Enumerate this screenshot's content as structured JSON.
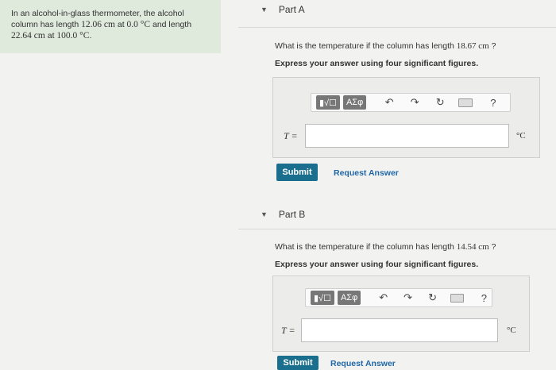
{
  "problem": {
    "line1": "In an alcohol-in-glass thermometer, the alcohol",
    "line2_pre": "column has length ",
    "line2_len": "12.06 cm",
    "line2_mid": " at ",
    "line2_temp": "0.0 °C",
    "line2_post": " and length",
    "line3_len": "22.64 cm",
    "line3_mid": " at ",
    "line3_temp": "100.0 °C",
    "line3_post": "."
  },
  "part_a": {
    "title": "Part A",
    "question_pre": "What is the temperature if the column has length ",
    "question_value": "18.67 cm",
    "question_post": " ?",
    "instruction": "Express your answer using four significant figures.",
    "toolbar": {
      "templates": "▮√☐",
      "greek": "ΑΣφ",
      "undo": "↶",
      "redo": "↷",
      "reset": "↻",
      "help": "?"
    },
    "variable": "T =",
    "input_value": "",
    "unit": "°C",
    "submit": "Submit",
    "request": "Request Answer"
  },
  "part_b": {
    "title": "Part B",
    "question_pre": "What is the temperature if the column has length ",
    "question_value": "14.54 cm",
    "question_post": " ?",
    "instruction": "Express your answer using four significant figures.",
    "toolbar": {
      "templates": "▮√☐",
      "greek": "ΑΣφ",
      "undo": "↶",
      "redo": "↷",
      "reset": "↻",
      "help": "?"
    },
    "variable": "T =",
    "input_value": "",
    "unit": "°C",
    "submit": "Submit",
    "request": "Request Answer"
  }
}
